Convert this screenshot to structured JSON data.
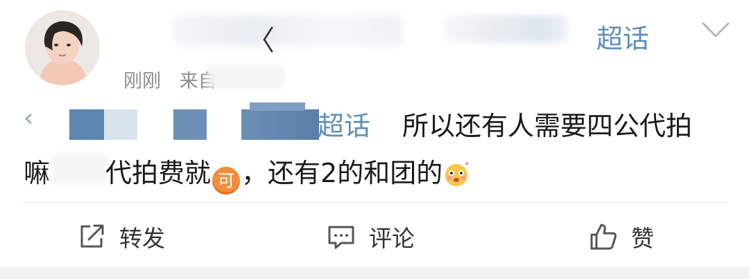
{
  "post": {
    "header": {
      "name_fragment": "〈",
      "topic_label": "超话",
      "time": "刚刚",
      "source_prefix": "来自"
    },
    "content": {
      "quote_mark": "‹",
      "topic_link": "超话",
      "line1_text": "所以还有人需要四公代拍",
      "line2_start": "嘛",
      "line2_mid": "代拍费就",
      "ke_badge": "可",
      "line2_end": "，还有2的和团的"
    },
    "actions": {
      "repost": "转发",
      "comment": "评论",
      "like": "赞"
    },
    "colors": {
      "link": "#5e8fba",
      "text": "#1a1a1a",
      "meta": "#8d8d8d"
    }
  }
}
